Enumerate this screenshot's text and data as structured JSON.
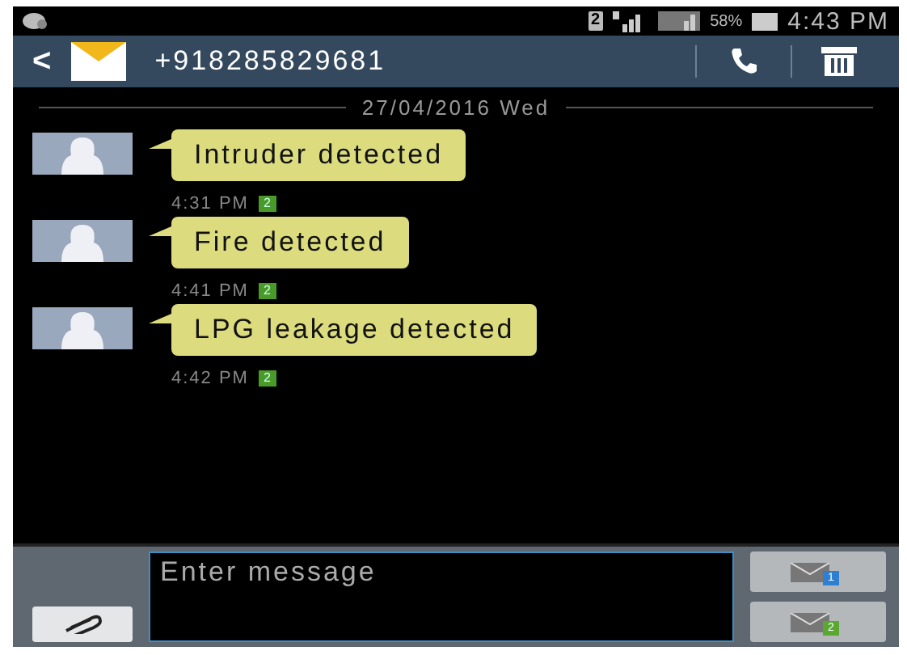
{
  "status_bar": {
    "sim_badge": "2",
    "battery_percent": "58%",
    "time": "4:43 PM"
  },
  "header": {
    "back": "<",
    "title": "+918285829681"
  },
  "date_divider": "27/04/2016 Wed",
  "messages": [
    {
      "text": "Intruder detected",
      "time": "4:31 PM",
      "sim": "2"
    },
    {
      "text": "Fire detected",
      "time": "4:41 PM",
      "sim": "2"
    },
    {
      "text": "LPG leakage detected",
      "time": "4:42 PM",
      "sim": "2"
    }
  ],
  "compose": {
    "placeholder": "Enter message",
    "send_buttons": [
      {
        "sim": "1",
        "color": "#2f7fd0"
      },
      {
        "sim": "2",
        "color": "#5aa832"
      }
    ]
  }
}
